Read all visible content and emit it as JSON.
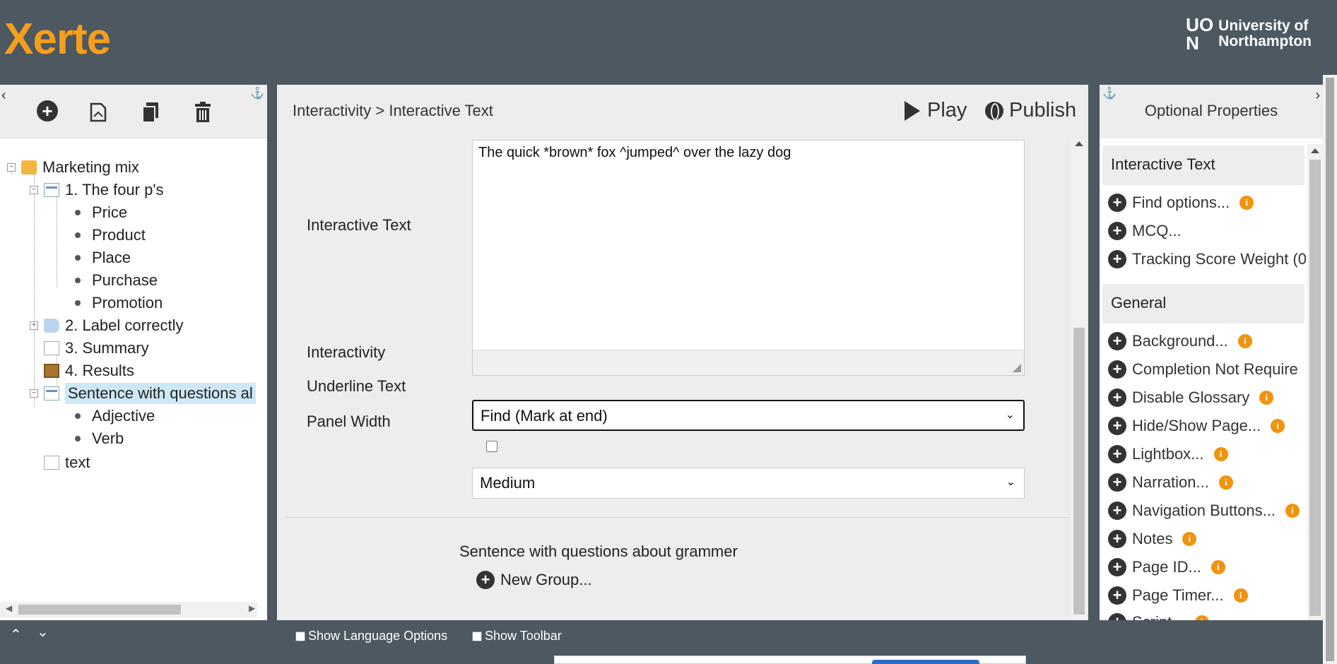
{
  "header": {
    "app_logo": "Xerte",
    "university_logo_mark": "UON",
    "university_logo_text": "University of\nNorthampton"
  },
  "left_panel": {
    "toolbar_icons": [
      "add-icon",
      "duplicate-page-icon",
      "copy-icon",
      "delete-icon"
    ],
    "tree": {
      "root": "Marketing mix",
      "page1": "1.  The four p's",
      "page1_items": [
        "Price",
        "Product",
        "Place",
        "Purchase",
        "Promotion"
      ],
      "page2": "2. Label correctly",
      "page3": "3. Summary",
      "page4": "4. Results",
      "page5": "Sentence with questions al",
      "page5_items": [
        "Adjective",
        "Verb"
      ],
      "page6": "text"
    }
  },
  "center_panel": {
    "breadcrumb": "Interactivity > Interactive Text",
    "play_label": "Play",
    "publish_label": "Publish",
    "fields": {
      "interactive_text_label": "Interactive Text",
      "interactive_text_value": "The quick *brown* fox ^jumped^ over the lazy dog",
      "interactivity_label": "Interactivity",
      "interactivity_value": "Find (Mark at end)",
      "underline_label": "Underline Text",
      "underline_checked": false,
      "panel_width_label": "Panel Width",
      "panel_width_value": "Medium"
    },
    "group_title": "Sentence with questions about grammer",
    "new_group_label": "New Group...",
    "footer": {
      "show_language_options": "Show Language Options",
      "show_toolbar": "Show Toolbar"
    }
  },
  "right_panel": {
    "title": "Optional Properties",
    "section1": "Interactive Text",
    "section1_items": [
      "Find options...",
      "MCQ...",
      "Tracking Score Weight (0"
    ],
    "section2": "General",
    "section2_items": [
      "Background...",
      "Completion Not Require",
      "Disable Glossary",
      "Hide/Show Page...",
      "Lightbox...",
      "Narration...",
      "Navigation Buttons...",
      "Notes",
      "Page ID...",
      "Page Timer...",
      "Script..."
    ],
    "info_glyph": "i"
  },
  "colors": {
    "header_bg": "#4d5860",
    "brand_orange": "#f59f1f",
    "info_orange": "#f0930d",
    "selection": "#cde8f7"
  }
}
